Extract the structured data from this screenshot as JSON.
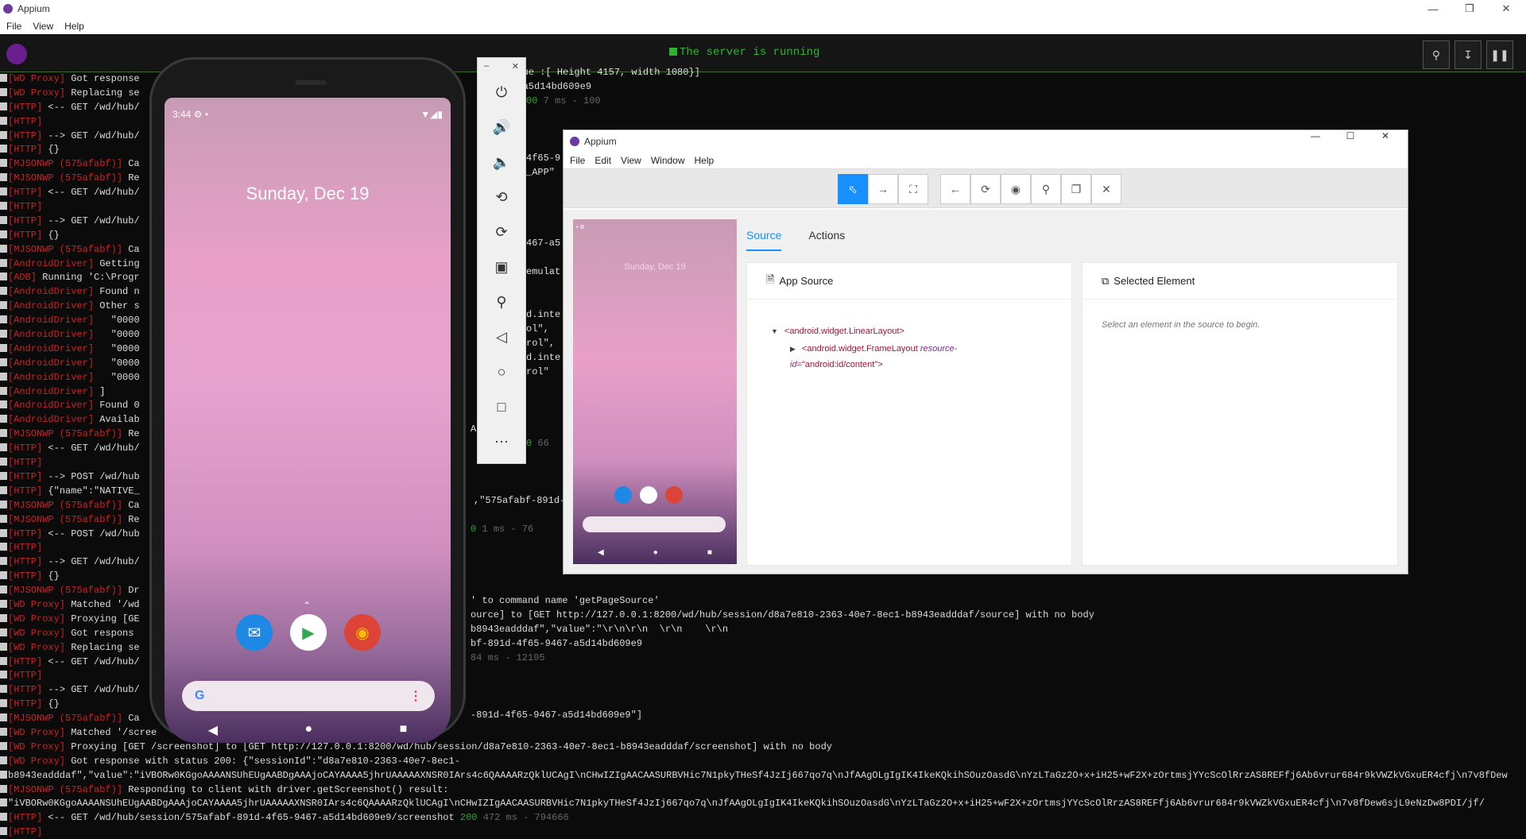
{
  "app": {
    "title": "Appium"
  },
  "menu": [
    "File",
    "View",
    "Help"
  ],
  "server": {
    "status": "The server is running"
  },
  "log_left": [
    {
      "tag": "[WD Proxy]",
      "text": " Got response"
    },
    {
      "tag": "[WD Proxy]",
      "text": " Replacing se"
    },
    {
      "tag": "[HTTP]",
      "text": " <-- GET /wd/hub/"
    },
    {
      "tag": "[HTTP]",
      "text": ""
    },
    {
      "tag": "[HTTP]",
      "text": " --> GET /wd/hub/"
    },
    {
      "tag": "[HTTP]",
      "text": " {}"
    },
    {
      "tag": "[MJSONWP (575afabf)]",
      "text": " Ca"
    },
    {
      "tag": "[MJSONWP (575afabf)]",
      "text": " Re"
    },
    {
      "tag": "[HTTP]",
      "text": " <-- GET /wd/hub/"
    },
    {
      "tag": "[HTTP]",
      "text": ""
    },
    {
      "tag": "[HTTP]",
      "text": " --> GET /wd/hub/"
    },
    {
      "tag": "[HTTP]",
      "text": " {}"
    },
    {
      "tag": "[MJSONWP (575afabf)]",
      "text": " Ca"
    },
    {
      "tag": "[AndroidDriver]",
      "text": " Getting"
    },
    {
      "tag": "[ADB]",
      "text": " Running 'C:\\Progr"
    },
    {
      "tag": "[AndroidDriver]",
      "text": " Found n"
    },
    {
      "tag": "[AndroidDriver]",
      "text": " Other s"
    },
    {
      "tag": "[AndroidDriver]",
      "text": "   \"0000"
    },
    {
      "tag": "[AndroidDriver]",
      "text": "   \"0000"
    },
    {
      "tag": "[AndroidDriver]",
      "text": "   \"0000"
    },
    {
      "tag": "[AndroidDriver]",
      "text": "   \"0000"
    },
    {
      "tag": "[AndroidDriver]",
      "text": "   \"0000"
    },
    {
      "tag": "[AndroidDriver]",
      "text": " ]"
    },
    {
      "tag": "[AndroidDriver]",
      "text": " Found 0"
    },
    {
      "tag": "[AndroidDriver]",
      "text": " Availab"
    },
    {
      "tag": "[MJSONWP (575afabf)]",
      "text": " Re"
    },
    {
      "tag": "[HTTP]",
      "text": " <-- GET /wd/hub/"
    },
    {
      "tag": "[HTTP]",
      "text": ""
    },
    {
      "tag": "[HTTP]",
      "text": " --> POST /wd/hub"
    },
    {
      "tag": "[HTTP]",
      "text": " {\"name\":\"NATIVE_"
    },
    {
      "tag": "[MJSONWP (575afabf)]",
      "text": " Ca"
    },
    {
      "tag": "[MJSONWP (575afabf)]",
      "text": " Re"
    },
    {
      "tag": "[HTTP]",
      "text": " <-- POST /wd/hub"
    },
    {
      "tag": "[HTTP]",
      "text": ""
    },
    {
      "tag": "[HTTP]",
      "text": " --> GET /wd/hub/"
    },
    {
      "tag": "[HTTP]",
      "text": " {}"
    },
    {
      "tag": "[MJSONWP (575afabf)]",
      "text": " Dr"
    },
    {
      "tag": "[WD Proxy]",
      "text": " Matched '/wd"
    },
    {
      "tag": "[WD Proxy]",
      "text": " Proxying [GE"
    },
    {
      "tag": "[WD Proxy]",
      "text": " Got respons"
    },
    {
      "tag": "[WD Proxy]",
      "text": " Replacing se"
    },
    {
      "tag": "[HTTP]",
      "text": " <-- GET /wd/hub/"
    },
    {
      "tag": "[HTTP]",
      "text": ""
    },
    {
      "tag": "[HTTP]",
      "text": " --> GET /wd/hub/"
    },
    {
      "tag": "[HTTP]",
      "text": " {}"
    },
    {
      "tag": "[MJSONWP (575afabf)]",
      "text": " Ca"
    },
    {
      "tag": "[WD Proxy]",
      "text": " Matched '/scree"
    },
    {
      "tag": "[WD Proxy]",
      "text": " Proxying [GET /screenshot] to [GET http://127.0.0.1:8200/wd/hub/session/d8a7e810-2363-40e7-8ec1-b8943eadddaf/screenshot] with no body"
    },
    {
      "tag": "[WD Proxy]",
      "text": " Got response with status 200: {\"sessionId\":\"d8a7e810-2363-40e7-8ec1-"
    },
    {
      "tag": "",
      "text": "b8943eadddaf\",\"value\":\"iVBORw0KGgoAAAANSUhEUgAABDgAAAjoCAYAAAA5jhrUAAAAAXNSR0IArs4c6QAAAARzQklUCAgI\\nCHwIZIgAACAASURBVHic7N1pkyTHeSf4JzIj667qo7q\\nJfAAgOLgIgIK4IkeKQkihSOuzOasdG\\nYzLTaGz2O+x+iH25+wF2X+zOrtmsjYYcScOlRrzAS8REFfj6Ab6vrur684r9kVWZkVGxuER4cfj\\n7v8fDew"
    },
    {
      "tag": "[MJSONWP (575afabf)]",
      "text": " Responding to client with driver.getScreenshot() result:"
    },
    {
      "tag": "",
      "text": "\"iVBORw0KGgoAAAANSUhEUgAABDgAAAjoCAYAAAA5jhrUAAAAAXNSR0IArs4c6QAAAARzQklUCAgI\\nCHwIZIgAACAASURBVHic7N1pkyTHeSf4JzIj667qo7q\\nJfAAgOLgIgIK4IkeKQkihSOuzOasdG\\nYzLTaGz2O+x+iH25+wF2X+zOrtmsjYYcScOlRrzAS8REFfj6Ab6vrur684r9kVWZkVGxuER4cfj\\n7v8fDew6sjL9eNzDw8PDI/jf/"
    },
    {
      "tag": "[HTTP]",
      "text": " <-- GET /wd/hub/session/575afabf-891d-4f65-9467-a5d14bd609e9/screenshot ",
      "tail": "200 ",
      "dim": "472 ms - 794666"
    },
    {
      "tag": "[HTTP]",
      "text": ""
    }
  ],
  "log_right": {
    "l1": "ar | value :[ Height 4157, width 1080}]",
    "l2": "65-9467-a5d14bd609e9",
    "l3_green": "00 ",
    "l3_dim": "7 ms - 100",
    "l4": "4f65-9",
    "l5": "_APP\"",
    "l6": "467-a5",
    "l7": "emulat",
    "l8": "d.inte",
    "l9": "ol\",",
    "l10": "rol\",",
    "l11": "d.inte",
    "l12": "rol\"",
    "l13": "A  ]",
    "l14_green": "0 ",
    "l14_dim": "66",
    "l15": ",\"575afabf-891d-",
    "l16_green": "0 ",
    "l16_dim": "1 ms - 76",
    "l17": "' to command name 'getPageSource'",
    "l18": "ource] to [GET http://127.0.0.1:8200/wd/hub/session/d8a7e810-2363-40e7-8ec1-b8943eadddaf/source] with no body",
    "l19": "b8943eadddaf\",\"value\":\"\\r\\n\\r\\n  \\r\\n    \\r\\n",
    "l20": "bf-891d-4f65-9467-a5d14bd609e9",
    "l21_dim": "84 ms - 12195",
    "l22": "-891d-4f65-9467-a5d14bd609e9\"]"
  },
  "phone": {
    "time": "3:44",
    "date": "Sunday, Dec 19"
  },
  "inspector": {
    "title": "Appium",
    "menu": [
      "File",
      "Edit",
      "View",
      "Window",
      "Help"
    ],
    "thumb_date": "Sunday, Dec 19",
    "tabs": [
      "Source",
      "Actions"
    ],
    "app_source": "App Source",
    "selected": "Selected Element",
    "tree_root": "<android.widget.LinearLayout>",
    "tree_child": "<android.widget.FrameLayout ",
    "tree_attr": "resource-",
    "tree_attr2": "id",
    "tree_val": "=\"android:id/content\">",
    "hint": "Select an element in the source to begin."
  },
  "colors": {
    "accent": "#1890ff",
    "server_green": "#2fb42f",
    "tag_red": "#cc2222"
  }
}
